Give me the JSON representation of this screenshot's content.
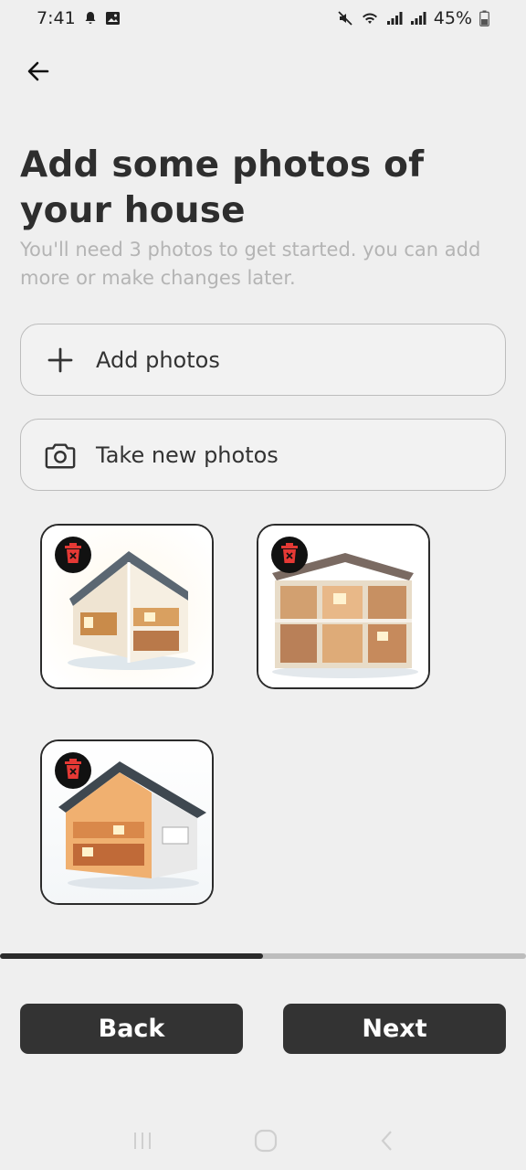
{
  "status_bar": {
    "time": "7:41",
    "battery": "45%",
    "icons": [
      "bell-icon",
      "image-icon",
      "mute-icon",
      "wifi-icon",
      "signal-icon",
      "signal-icon",
      "battery-icon"
    ]
  },
  "header": {
    "back_icon": "arrow-left-icon",
    "title": "Add some photos of your house",
    "subtitle": "You'll need 3 photos to get started. you can add more or make changes later."
  },
  "actions": {
    "add_photos_label": "Add photos",
    "add_photos_icon": "plus-icon",
    "take_photos_label": "Take new photos",
    "take_photos_icon": "camera-icon"
  },
  "photos": [
    {
      "name": "house-photo-1",
      "delete_icon": "trash-icon"
    },
    {
      "name": "house-photo-2",
      "delete_icon": "trash-icon"
    },
    {
      "name": "house-photo-3",
      "delete_icon": "trash-icon"
    }
  ],
  "progress": {
    "fraction": 0.5
  },
  "footer": {
    "back_label": "Back",
    "next_label": "Next"
  },
  "colors": {
    "background": "#efefef",
    "primary_button": "#333333",
    "delete_icon_red": "#e53935",
    "subtitle_text": "#b4b4b4"
  }
}
